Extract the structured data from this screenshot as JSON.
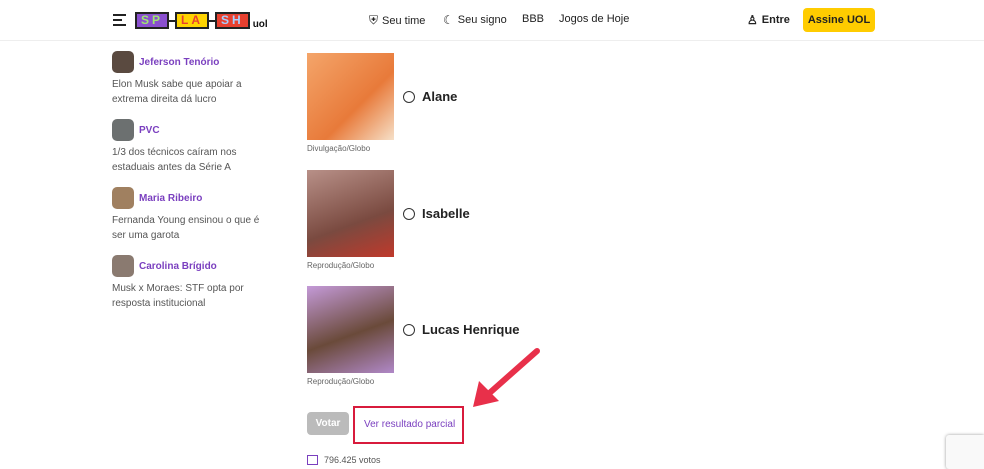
{
  "header": {
    "logo": [
      "SP",
      "LA",
      "SH"
    ],
    "logo_suffix": "uol",
    "nav": [
      "Seu time",
      "Seu signo",
      "BBB",
      "Jogos de Hoje"
    ],
    "login": "Entre",
    "subscribe": "Assine UOL"
  },
  "columnists": [
    {
      "name": "Jeferson Tenório",
      "text": "Elon Musk sabe que apoiar a extrema direita dá lucro"
    },
    {
      "name": "PVC",
      "text": "1/3 dos técnicos caíram nos estaduais antes da Série A"
    },
    {
      "name": "Maria Ribeiro",
      "text": "Fernanda Young ensinou o que é ser uma garota"
    },
    {
      "name": "Carolina Brígido",
      "text": "Musk x Moraes: STF opta por resposta institucional"
    }
  ],
  "poll": {
    "options": [
      {
        "name": "Alane",
        "credit": "Divulgação/Globo"
      },
      {
        "name": "Isabelle",
        "credit": "Reprodução/Globo"
      },
      {
        "name": "Lucas Henrique",
        "credit": "Reprodução/Globo"
      }
    ],
    "vote_label": "Votar",
    "partial_label": "Ver resultado parcial",
    "votes": "796.425 votos"
  },
  "colors": {
    "accent": "#7a3fbf",
    "highlight": "#d81b3c",
    "subscribe": "#ffcc00"
  }
}
